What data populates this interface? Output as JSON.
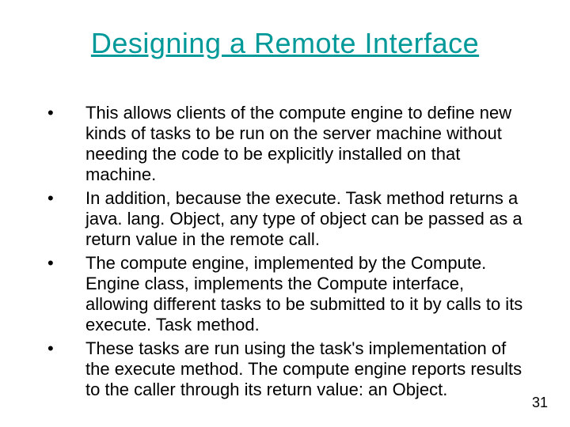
{
  "title": "Designing a Remote Interface",
  "bullets": [
    "This allows clients of the compute engine to define new kinds of tasks to be run on the server machine without needing the code to be explicitly installed on that machine.",
    "In addition, because the execute. Task method returns a java. lang. Object, any type of object can be passed as a return value in the remote call.",
    "The compute engine, implemented by the Compute. Engine class, implements the Compute interface, allowing different tasks to be submitted to it by calls to its execute. Task method.",
    "These tasks are run using the task's implementation of the execute method. The compute engine reports results to the caller through its return value: an Object."
  ],
  "bullet_marker": "•",
  "page_number": "31"
}
